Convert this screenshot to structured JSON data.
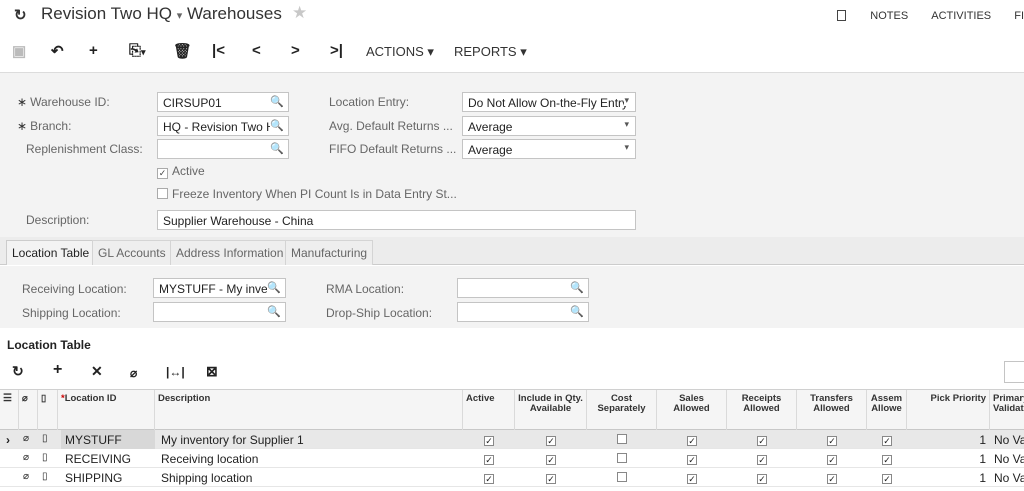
{
  "title": {
    "company": "Revision Two HQ",
    "separator": "▾",
    "screen": "Warehouses"
  },
  "top_links": {
    "notes": "NOTES",
    "activities": "ACTIVITIES",
    "files": "FI"
  },
  "toolbar": {
    "actions": "ACTIONS ▾",
    "reports": "REPORTS ▾"
  },
  "form": {
    "warehouse_id_label": "Warehouse ID:",
    "warehouse_id": "CIRSUP01",
    "branch_label": "Branch:",
    "branch": "HQ - Revision Two H",
    "replenishment_label": "Replenishment Class:",
    "replenishment": "",
    "active_label": "Active",
    "freeze_label": "Freeze Inventory When PI Count Is in Data Entry St...",
    "description_label": "Description:",
    "description": "Supplier Warehouse - China",
    "location_entry_label": "Location Entry:",
    "location_entry": "Do Not Allow On-the-Fly Entry",
    "avg_returns_label": "Avg. Default Returns ...",
    "avg_returns": "Average",
    "fifo_returns_label": "FIFO Default Returns ...",
    "fifo_returns": "Average"
  },
  "tabs": [
    {
      "label": "Location Table"
    },
    {
      "label": "GL Accounts"
    },
    {
      "label": "Address Information"
    },
    {
      "label": "Manufacturing"
    }
  ],
  "tab_body": {
    "receiving_label": "Receiving Location:",
    "receiving": "MYSTUFF - My inve",
    "shipping_label": "Shipping Location:",
    "shipping": "",
    "rma_label": "RMA Location:",
    "rma": "",
    "dropship_label": "Drop-Ship Location:",
    "dropship": ""
  },
  "location_table": {
    "title": "Location Table",
    "headers": {
      "location_id": "Location ID",
      "description": "Description",
      "active": "Active",
      "include_qty": "Include in Qty. Available",
      "cost_sep": "Cost Separately",
      "sales": "Sales Allowed",
      "receipts": "Receipts Allowed",
      "transfers": "Transfers Allowed",
      "assembly": "Assem Allowe",
      "pick_priority": "Pick Priority",
      "primary_validation": "Primary Validati"
    },
    "rows": [
      {
        "location_id": "MYSTUFF",
        "description": "My inventory for Supplier 1",
        "active": true,
        "include_qty": true,
        "cost_sep": false,
        "sales": true,
        "receipts": true,
        "transfers": true,
        "assembly": true,
        "pick_priority": "1",
        "primary_validation": "No Va"
      },
      {
        "location_id": "RECEIVING",
        "description": "Receiving location",
        "active": true,
        "include_qty": true,
        "cost_sep": false,
        "sales": true,
        "receipts": true,
        "transfers": true,
        "assembly": true,
        "pick_priority": "1",
        "primary_validation": "No Va"
      },
      {
        "location_id": "SHIPPING",
        "description": "Shipping location",
        "active": true,
        "include_qty": true,
        "cost_sep": false,
        "sales": true,
        "receipts": true,
        "transfers": true,
        "assembly": true,
        "pick_priority": "1",
        "primary_validation": "No Va"
      }
    ]
  }
}
